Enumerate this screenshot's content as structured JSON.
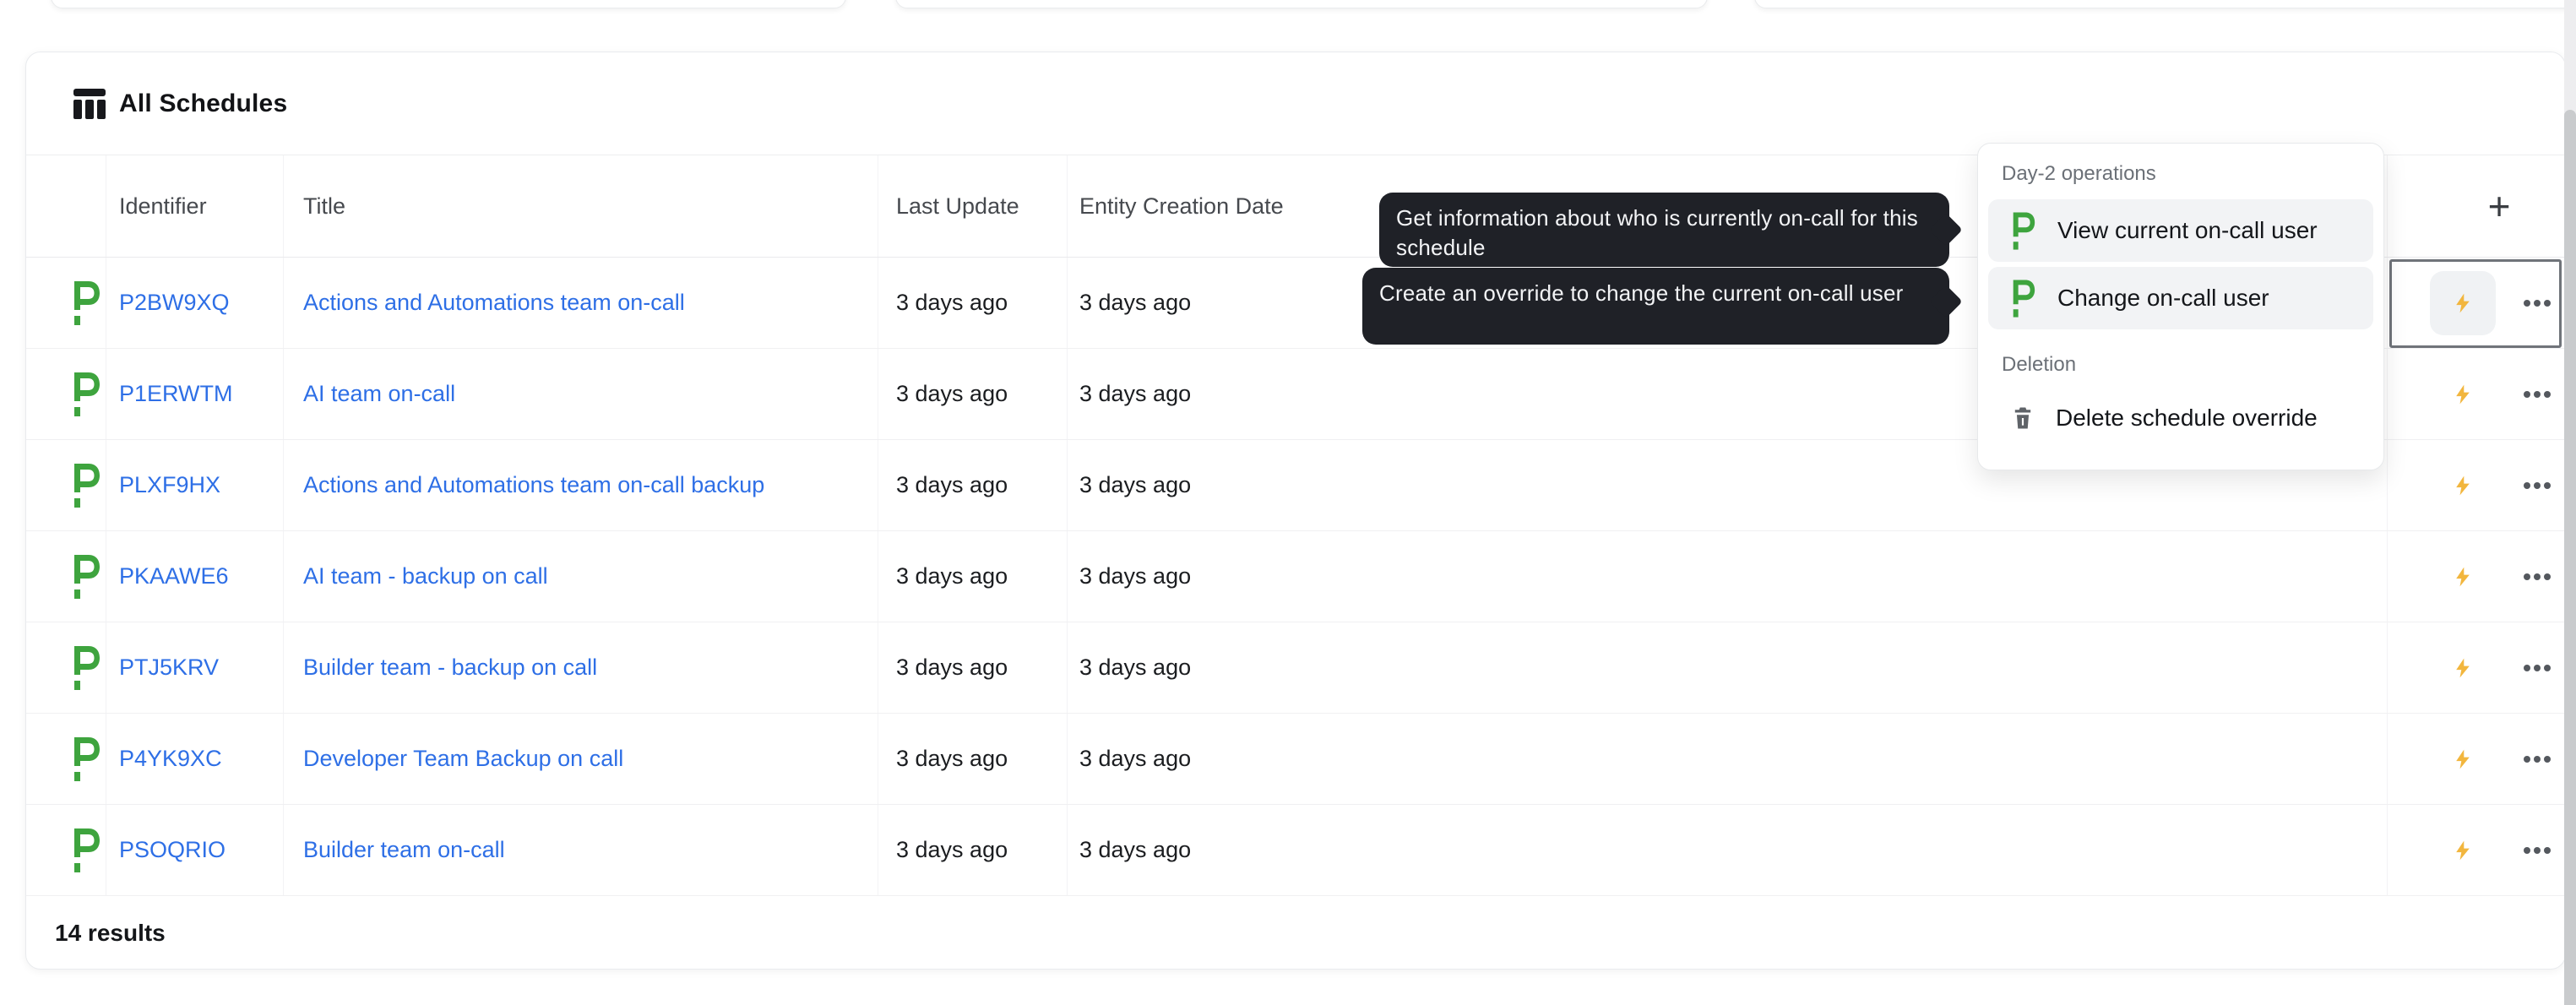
{
  "panel": {
    "title": "All Schedules",
    "results_label": "14 results",
    "add_button_label": "+",
    "columns": {
      "identifier": "Identifier",
      "title": "Title",
      "last_update": "Last Update",
      "entity_creation_date": "Entity Creation Date"
    }
  },
  "table": {
    "rows": [
      {
        "identifier": "P2BW9XQ",
        "title": "Actions and Automations team on-call",
        "last_update": "3 days ago",
        "entity_creation_date": "3 days ago"
      },
      {
        "identifier": "P1ERWTM",
        "title": "AI team on-call",
        "last_update": "3 days ago",
        "entity_creation_date": "3 days ago"
      },
      {
        "identifier": "PLXF9HX",
        "title": "Actions and Automations team on-call backup",
        "last_update": "3 days ago",
        "entity_creation_date": "3 days ago"
      },
      {
        "identifier": "PKAAWE6",
        "title": "AI team - backup on call",
        "last_update": "3 days ago",
        "entity_creation_date": "3 days ago"
      },
      {
        "identifier": "PTJ5KRV",
        "title": "Builder team - backup on call",
        "last_update": "3 days ago",
        "entity_creation_date": "3 days ago"
      },
      {
        "identifier": "P4YK9XC",
        "title": "Developer Team Backup on call",
        "last_update": "3 days ago",
        "entity_creation_date": "3 days ago"
      },
      {
        "identifier": "PSOQRIO",
        "title": "Builder team on-call",
        "last_update": "3 days ago",
        "entity_creation_date": "3 days ago"
      }
    ]
  },
  "tooltip": {
    "view_text": "Get information about who is currently on-call for this schedule",
    "change_text": "Create an override to change the current on-call user"
  },
  "menu": {
    "day2_section_label": "Day-2 operations",
    "deletion_section_label": "Deletion",
    "items": {
      "view": "View current on-call user",
      "change": "Change on-call user",
      "delete": "Delete schedule override"
    }
  },
  "colors": {
    "brand_green": "#3ea43e",
    "link_blue": "#2e6fe6",
    "bolt_yellow": "#f2b63e",
    "tooltip_bg": "#1f2127",
    "focus_ring": "#70747a"
  }
}
